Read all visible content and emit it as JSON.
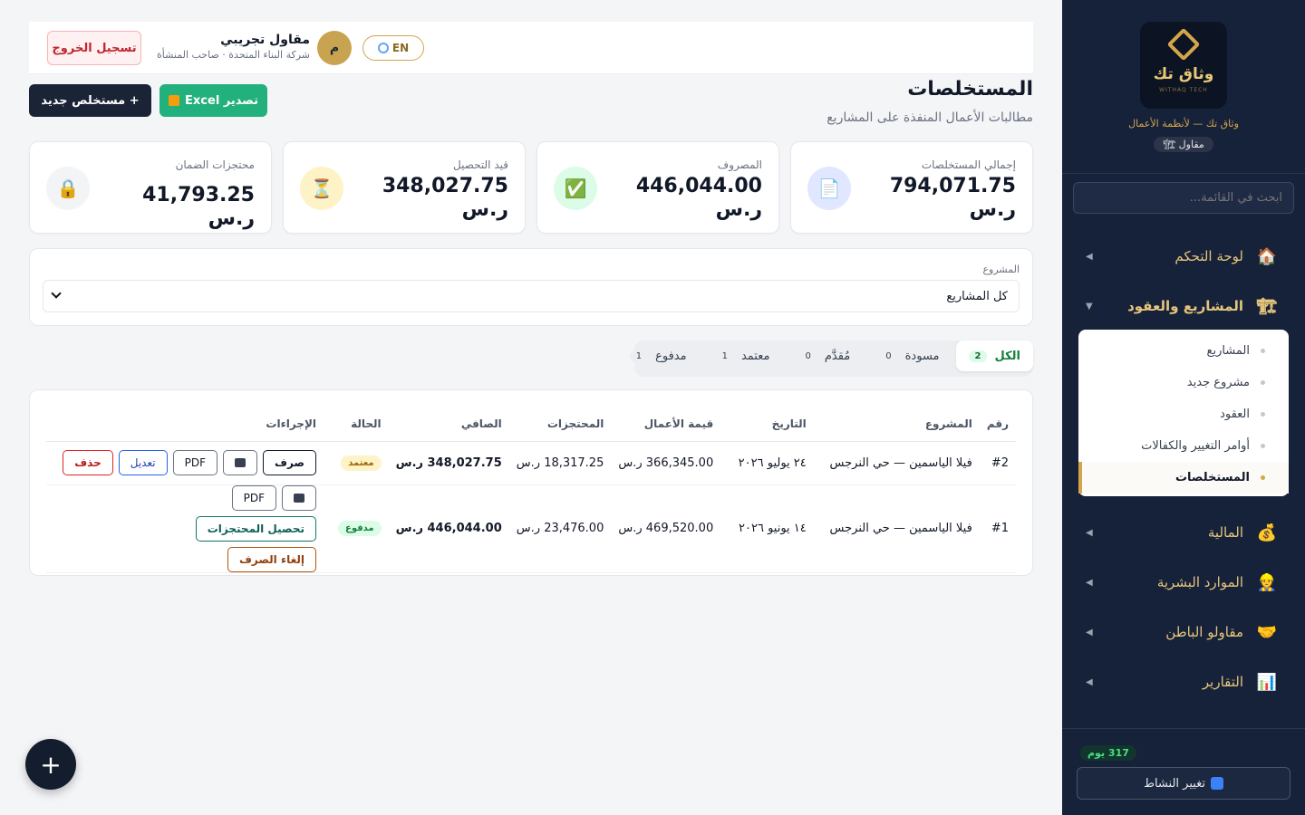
{
  "sidebar": {
    "logo_text": "وثاق تك",
    "logo_sub": "WITHAQ TECH",
    "tagline": "وثاق تك — لأنظمة الأعمال",
    "role": "مقاول",
    "search_placeholder": "ابحث في القائمة...",
    "nav": [
      {
        "label": "لوحة التحكم",
        "icon": "house-icon"
      },
      {
        "label": "المشاريع والعقود",
        "icon": "crane-icon"
      },
      {
        "label": "المالية",
        "icon": "money-bag-icon"
      },
      {
        "label": "الموارد البشرية",
        "icon": "worker-icon"
      },
      {
        "label": "مقاولو الباطن",
        "icon": "handshake-icon"
      },
      {
        "label": "التقارير",
        "icon": "bar-chart-icon"
      }
    ],
    "submenu": [
      "المشاريع",
      "مشروع جديد",
      "العقود",
      "أوامر التغيير والكفالات",
      "المستخلصات"
    ],
    "days_left": "317 يوم",
    "switch_label": "تغيير النشاط"
  },
  "topbar": {
    "logout": "تسجيل الخروج",
    "user_name": "مقاول تجريبي",
    "user_sub": "شركة البناء المتحدة · صاحب المنشأة",
    "avatar_letter": "م",
    "lang": "EN"
  },
  "page": {
    "title": "المستخلصات",
    "subtitle": "مطالبات الأعمال المنفذة على المشاريع",
    "new_btn": "+ مستخلص جديد",
    "excel_btn": "تصدير Excel"
  },
  "stats": [
    {
      "label": "إجمالي المستخلصات",
      "value": "794,071.75 ر.س",
      "icon": "document-icon",
      "color": "#e0e7ff"
    },
    {
      "label": "المصروف",
      "value": "446,044.00 ر.س",
      "icon": "check-icon",
      "color": "#dcfce7"
    },
    {
      "label": "قيد التحصيل",
      "value": "348,027.75 ر.س",
      "icon": "hourglass-icon",
      "color": "#fef3c7"
    },
    {
      "label": "محتجزات الضمان",
      "value": "41,793.25 ر.س",
      "icon": "lock-icon",
      "color": "#f3f4f6"
    }
  ],
  "filter": {
    "label": "المشروع",
    "value": "كل المشاريع"
  },
  "tabs": [
    {
      "label": "الكل",
      "count": "2"
    },
    {
      "label": "مسودة",
      "count": "0"
    },
    {
      "label": "مُقدَّم",
      "count": "0"
    },
    {
      "label": "معتمد",
      "count": "1"
    },
    {
      "label": "مدفوع",
      "count": "1"
    }
  ],
  "table": {
    "headers": [
      "رقم",
      "المشروع",
      "التاريخ",
      "قيمة الأعمال",
      "المحتجزات",
      "الصافي",
      "الحالة",
      "الإجراءات"
    ],
    "rows": [
      {
        "num": "#2",
        "project": "فيلا الياسمين — حي النرجس",
        "date": "٢٤ يوليو ٢٠٢٦",
        "value": "366,345.00 ر.س",
        "retention": "18,317.25 ر.س",
        "net": "348,027.75 ر.س",
        "status": "معتمد",
        "actions": {
          "disburse": "صرف",
          "pdf": "PDF",
          "edit": "تعديل",
          "delete": "حذف"
        }
      },
      {
        "num": "#1",
        "project": "فيلا الياسمين — حي النرجس",
        "date": "١٤ يونيو ٢٠٢٦",
        "value": "469,520.00 ر.س",
        "retention": "23,476.00 ر.س",
        "net": "446,044.00 ر.س",
        "status": "مدفوع",
        "actions": {
          "pdf": "PDF",
          "collect": "تحصيل المحتجزات",
          "cancel": "إلغاء الصرف"
        }
      }
    ]
  },
  "fab": "+"
}
